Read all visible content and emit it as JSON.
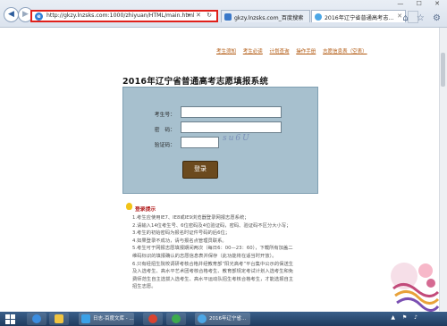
{
  "browser": {
    "url": "http://gkzy.lnzsks.com:1000/zhiyuan/HTML/main.html",
    "address_tools": "▾ ✕ ↻",
    "tabs": [
      {
        "label": "gkzy.lnzsks.com_百度搜索"
      },
      {
        "label": "2016年辽宁省普通高考志..."
      }
    ],
    "tab_close": "✕",
    "window_buttons": "— ☐ ✕",
    "toolbar_icons": "⌂ ☆ ⚙"
  },
  "page": {
    "top_links": [
      "考生须知",
      "考生必读",
      "计划查询",
      "操作手册",
      "志愿信息表（空表）"
    ],
    "title": "2016年辽宁省普通高考志愿填报系统",
    "form": {
      "exam_id_label": "考生号：",
      "password_label": "密　码：",
      "captcha_label": "验证码：",
      "captcha_text": "su6U",
      "login_button": "登录"
    },
    "tips": {
      "heading": "登录提示",
      "items": [
        "1.考生应使用IE7、IE8或IE9浏览器登录网报志愿系统；",
        "2.请输入14位考生号、6位密码及4位验证码，密码、验证码不区分大小写；",
        "3.考生的初始密码为报名时证件号码的后6位；",
        "4.如果登录不成功，请与报名点管理员联系。",
        "5.考生可于网报志愿填报期间两次（每日6：00—23：60），下载所有加盖二",
        "维码标识的填报确认的志愿信息表并保存（此功能将在适当时开放）。",
        "6.只有经招生院校调研考核合格并经教育部“阳光高考”平台集中公示的保送生",
        "及入选考生、高水平艺术团考核合格考生、教育部规定考试计划入选考生和免",
        "费师范生自主选拔入选考生、高水平运动队招生考核合格考生，才能选报自主",
        "招生志愿。"
      ]
    }
  },
  "taskbar": {
    "apps": [
      {
        "label": "日志-百度文库 - ..."
      },
      {
        "label": "2016年辽宁省..."
      }
    ],
    "tray": "▲ ⚑ ♪"
  },
  "colors": {
    "address_border": "#e0201a",
    "login_box": "#a7c0ce",
    "login_button": "#6b4a1e",
    "links": "#b25a12",
    "tips_heading": "#b01a1a"
  }
}
